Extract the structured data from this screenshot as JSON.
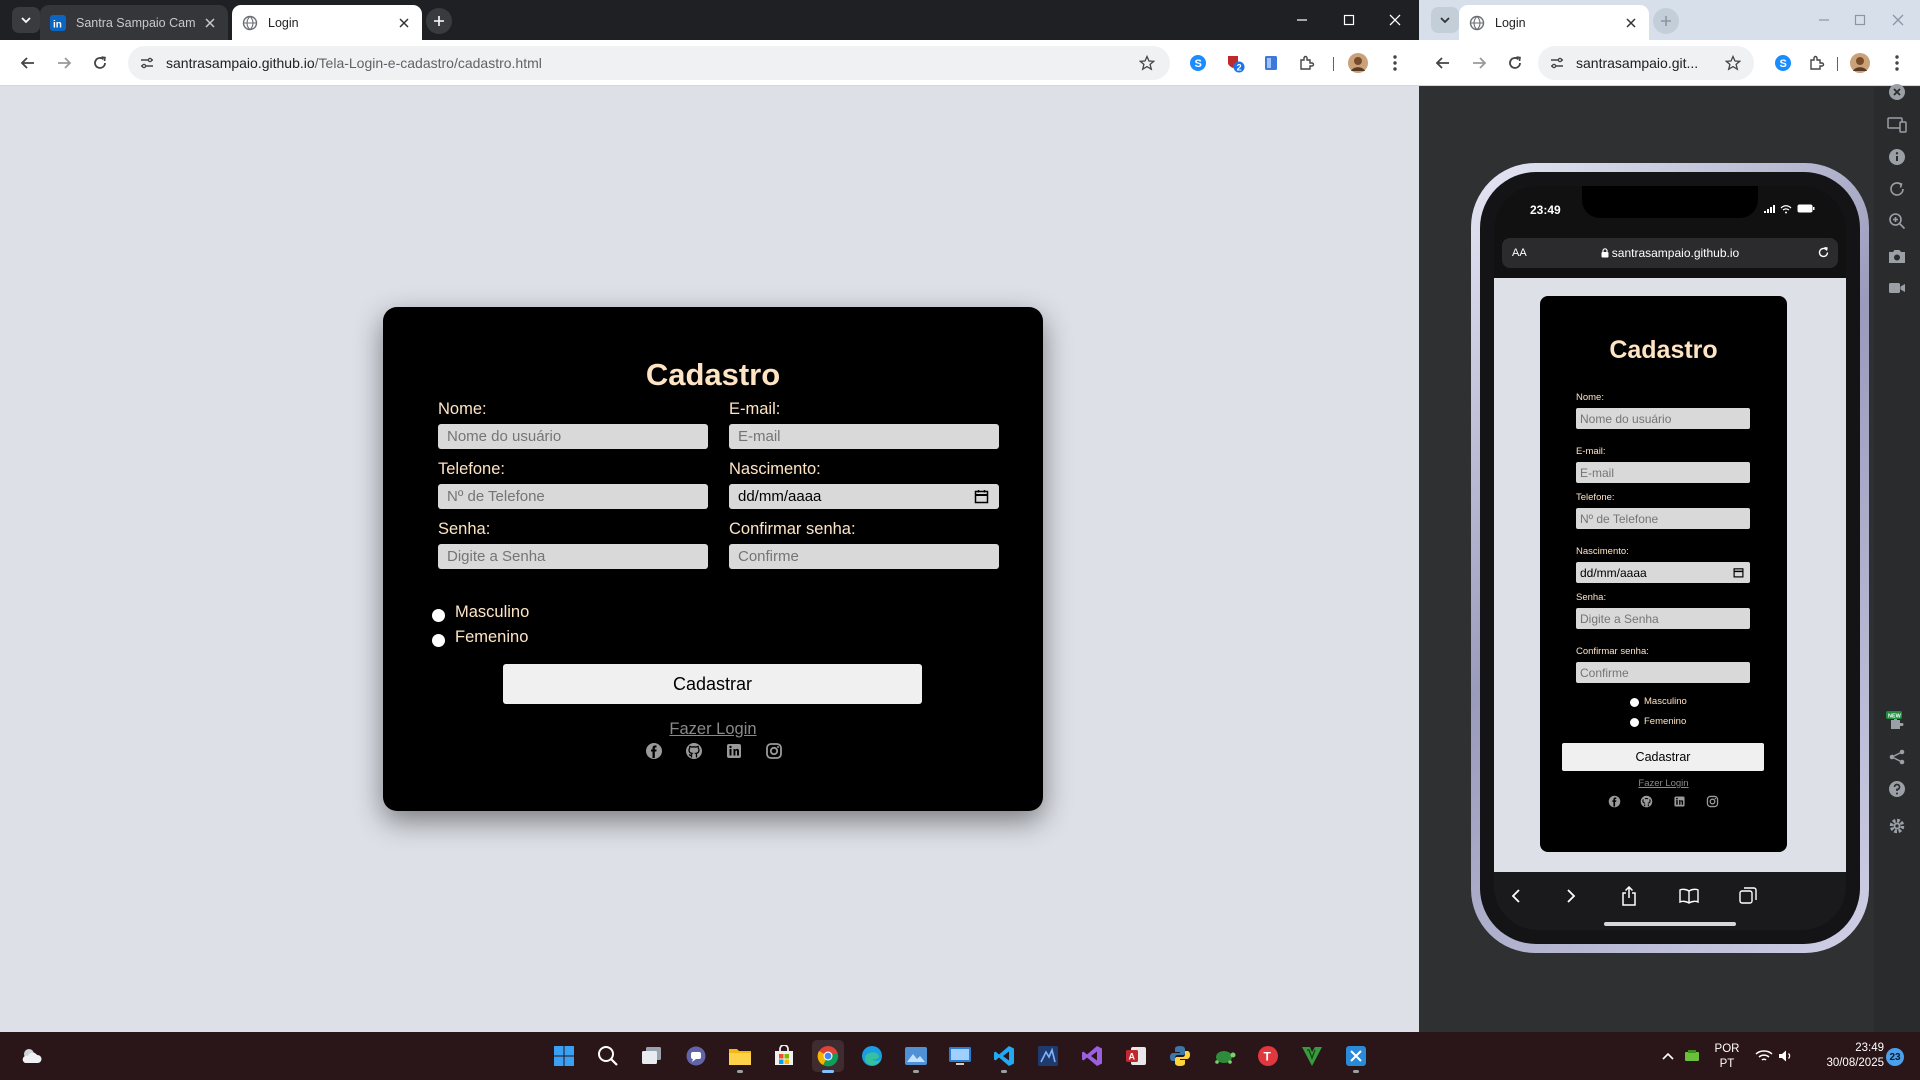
{
  "left_window": {
    "tabs": [
      {
        "title": "Santra Sampaio Camolo | LinkedIn",
        "active": false
      },
      {
        "title": "Login",
        "active": true
      }
    ],
    "address": {
      "domain": "santrasampaio.github.io",
      "path": "/Tela-Login-e-cadastro/cadastro.html"
    },
    "extension_badge": "2"
  },
  "form": {
    "title": "Cadastro",
    "fields": {
      "nome": {
        "label": "Nome:",
        "placeholder": "Nome do usuário"
      },
      "email": {
        "label": "E-mail:",
        "placeholder": "E-mail"
      },
      "telefone": {
        "label": "Telefone:",
        "placeholder": "Nº de Telefone"
      },
      "nascimento": {
        "label": "Nascimento:",
        "value": "dd/mm/aaaa"
      },
      "senha": {
        "label": "Senha:",
        "placeholder": "Digite a Senha"
      },
      "confirmar": {
        "label": "Confirmar senha:",
        "placeholder": "Confirme"
      }
    },
    "gender_options": [
      "Masculino",
      "Femenino"
    ],
    "submit_label": "Cadastrar",
    "login_link": "Fazer Login",
    "social_icons": [
      "facebook-icon",
      "github-icon",
      "linkedin-icon",
      "instagram-icon"
    ]
  },
  "right_window": {
    "tab_title": "Login",
    "address": "santrasampaio.git...",
    "phone": {
      "time": "23:49",
      "aa_label": "AA",
      "url": "santrasampaio.github.io",
      "date_field_value": "dd/mm/aaaa"
    }
  },
  "taskbar": {
    "lang_line1": "POR",
    "lang_line2": "PT",
    "time": "23:49",
    "date": "30/08/2025",
    "notification_count": "23"
  },
  "colors": {
    "accent_text": "#ffe4c4",
    "page_bg": "#dde0e7",
    "card_bg": "#000000",
    "taskbar_bg": "#2a1519"
  }
}
